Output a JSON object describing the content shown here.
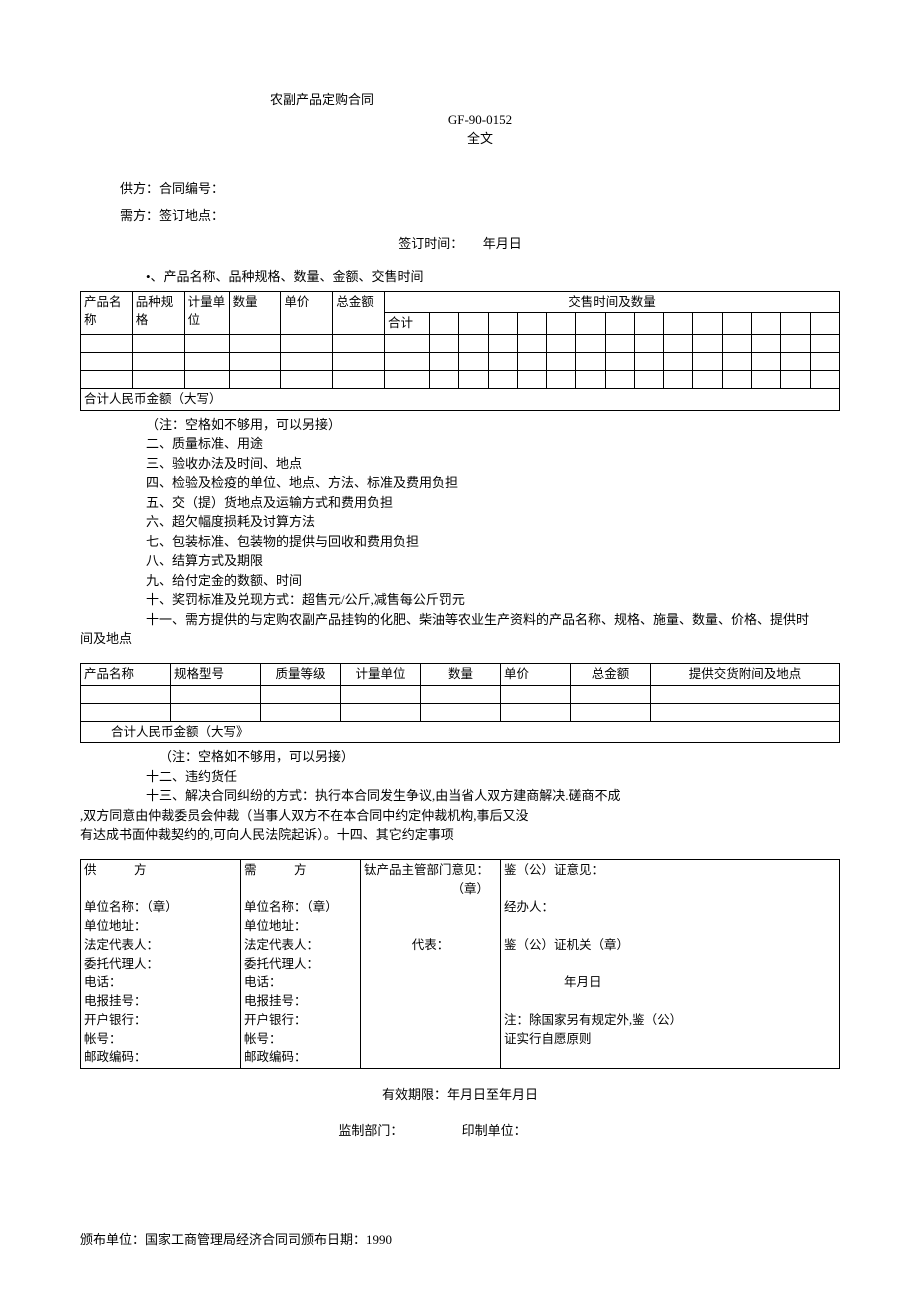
{
  "title": {
    "main": "农副产品定购合同",
    "code": "GF-90-0152",
    "full": "全文"
  },
  "parties": {
    "supplier_line": "供方：合同编号：",
    "demander_line": "需方：签订地点：",
    "sign_time_label": "签订时间：",
    "sign_time_value": "年月日"
  },
  "section1_heading": "•、产品名称、品种规格、数量、金额、交售时间",
  "table1": {
    "h_product": "产品名称",
    "h_spec": "品种规格",
    "h_unit": "计量单位",
    "h_qty": "数量",
    "h_price": "单价",
    "h_total": "总金额",
    "h_deliver": "交售时间及数量",
    "h_sum": "合计",
    "footer": "合计人民币金额（大写）"
  },
  "clauses": {
    "note1": "（注：空格如不够用，可以另接）",
    "c2": "二、质量标准、用途",
    "c3": "三、验收办法及时间、地点",
    "c4": "四、检验及检疫的单位、地点、方法、标准及费用负担",
    "c5": "五、交（提）货地点及运输方式和费用负担",
    "c6": "六、超欠幅度损耗及讨算方法",
    "c7": "七、包装标准、包装物的提供与回收和费用负担",
    "c8": "八、结算方式及期限",
    "c9": "九、给付定金的数额、时间",
    "c10": "十、奖罚标准及兑现方式：超售元/公斤,减售每公斤罚元",
    "c11a": "十一、需方提供的与定购农副产品挂钩的化肥、柴油等农业生产资料的产品名称、规格、施量、数量、价格、提供时",
    "c11b": "间及地点"
  },
  "table2": {
    "h_product": "产品名称",
    "h_model": "规格型号",
    "h_grade": "质量等级",
    "h_unit": "计量单位",
    "h_qty": "数量",
    "h_price": "单价",
    "h_total": "总金额",
    "h_deliver": "提供交货附间及地点",
    "footer": "合计人民币金额（大写》"
  },
  "clauses2": {
    "note2": "（注：空格如不够用，可以另接）",
    "c12": "十二、违约货任",
    "c13a": "十三、解决合同纠纷的方式：执行本合同发生争议,由当省人双方建商解决.磋商不成",
    "c13b": ",双方同意由仲裁委员会仲裁（当事人双方不在本合同中约定仲裁机构,事后又没",
    "c13c": "有达成书面仲裁契约的,可向人民法院起诉）。十四、其它约定事项"
  },
  "sig": {
    "col1_head": "供　　　方",
    "col2_head": "需　　　方",
    "col3_head": "钛产品主管部门意见：",
    "col3_seal": "（章）",
    "col4_head": "鉴（公）证意见：",
    "unit_name": "单位名称：（章）",
    "unit_addr": "单位地址：",
    "legal_rep": "法定代表人：",
    "agent": "委托代理人：",
    "phone": "电话：",
    "teleg": "电报挂号：",
    "bank": "开户银行：",
    "acct": "帐号：",
    "postcode": "邮政编码：",
    "col3_rep": "代表：",
    "col4_handler": "经办人：",
    "col4_org": "鉴（公）证机关（章）",
    "col4_date": "年月日",
    "col4_note1": "注：除国家另有规定外,鉴（公）",
    "col4_note2": "证实行自愿原则"
  },
  "footer": {
    "valid": "有效期限：年月日至年月日",
    "supervise_label": "监制部门：",
    "print_label": "印制单位：",
    "issuer": "颁布单位：国家工商管理局经济合同司颁布日期：1990"
  }
}
